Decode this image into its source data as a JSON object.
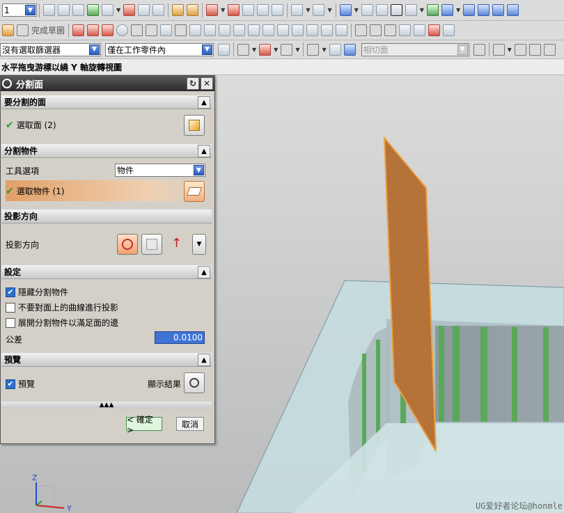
{
  "toolbar1": {
    "layer_value": "1"
  },
  "toolbar2": {
    "sketch_label": "完成草圖"
  },
  "toolbar3": {
    "filter_value": "沒有選取篩選器",
    "scope_value": "僅在工作零件內",
    "snap_value": "相切面"
  },
  "statusbar": {
    "message": "水平拖曳游標以繞 Y 軸旋轉視圖"
  },
  "dialog": {
    "title": "分割面",
    "sections": {
      "face": {
        "header": "要分割的面",
        "select_label": "選取面 (2)"
      },
      "object": {
        "header": "分割物件",
        "tool_label": "工具選項",
        "tool_value": "物件",
        "select_label": "選取物件 (1)"
      },
      "projection": {
        "header": "投影方向",
        "label": "投影方向"
      },
      "settings": {
        "header": "設定",
        "hide_label": "隱藏分割物件",
        "no_project_label": "不要對面上的曲線進行投影",
        "expand_label": "展開分割物件以滿足面的邊",
        "tolerance_label": "公差",
        "tolerance_value": "0.0100"
      },
      "preview": {
        "header": "預覽",
        "preview_label": "預覽",
        "show_result_label": "顯示結果"
      }
    },
    "ok_label": "< 確定 >",
    "cancel_label": "取消"
  },
  "axes": {
    "z": "Z",
    "y": "Y"
  },
  "watermark": "UG爱好者论坛@honmle",
  "colors": {
    "plane": "#b5733a",
    "part": "#c6dde0",
    "stripe": "#5aa85a"
  }
}
